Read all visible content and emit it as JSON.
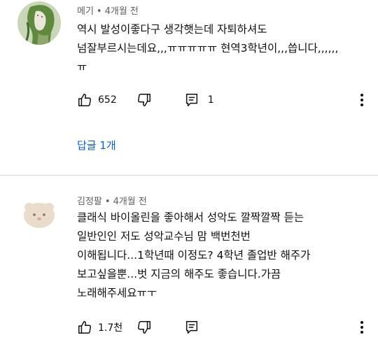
{
  "comments": [
    {
      "author": "메기",
      "time": "4개월 전",
      "lines": [
        "역시 발성이좋다구 생각햇는데 자퇴하셔도",
        "넘잘부르시는데요,,,ㅠㅠㅠㅠㅠ 현역3학년이,,,씁니다,,,,,,",
        "ㅠ"
      ],
      "likes": "652",
      "replies_count": "1",
      "replies_link": "답글 1개",
      "avatar_color": "#6f8f4f"
    },
    {
      "author": "김정팔",
      "time": "4개월 전",
      "lines": [
        "클래식 바이올린을 좋아해서 성악도 깔짝깔짝 듣는",
        "일반인인 저도 성악교수님 맘 백번천번",
        "이해됩니다...1학년때 이정도? 4학년 졸업반 해주가",
        "보고싶을뿐...벗 지금의 해주도 좋습니다.가끔",
        "노래해주세요ㅠㅜ"
      ],
      "likes": "1.7천",
      "avatar_color": "#e8d9c6"
    }
  ],
  "colors": {
    "link": "#065fd4",
    "meta": "#606060",
    "divider": "#d8d8d8"
  },
  "icons": [
    "thumbs-up-icon",
    "thumbs-down-icon",
    "reply-icon",
    "more-vert-icon"
  ]
}
